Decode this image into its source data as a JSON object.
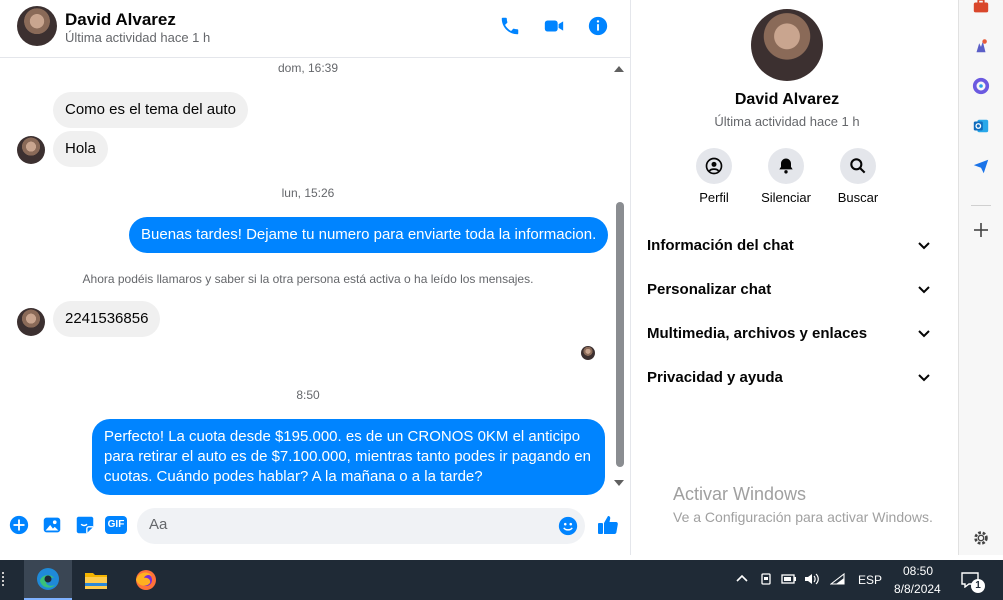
{
  "chat": {
    "name": "David Alvarez",
    "status": "Última actividad hace 1 h"
  },
  "messages": {
    "ts1": "dom, 16:39",
    "msg1": "Como es el tema del auto",
    "msg2": "Hola",
    "ts2": "lun, 15:26",
    "msg3": "Buenas tardes! Dejame tu numero para enviarte toda la informacion.",
    "notice": "Ahora podéis llamaros y saber si la otra persona está activa o ha leído los mensajes.",
    "msg4": "2241536856",
    "ts3": "8:50",
    "msg5_line1": "Perfecto! La cuota desde $195.000. es de un CRONOS 0KM el anticipo",
    "msg5_line2": "para retirar el auto es de $7.100.000, mientras tanto podes ir pagando en",
    "msg5_line3": "cuotas. Cuándo podes hablar? A la mañana o a la tarde?"
  },
  "composer": {
    "placeholder": "Aa",
    "gif_label": "GIF"
  },
  "info": {
    "name": "David Alvarez",
    "status": "Última actividad hace 1 h",
    "actions": [
      "Perfil",
      "Silenciar",
      "Buscar"
    ],
    "sections": [
      "Información del chat",
      "Personalizar chat",
      "Multimedia, archivos y enlaces",
      "Privacidad y ayuda"
    ]
  },
  "watermark": {
    "title": "Activar Windows",
    "subtitle": "Ve a Configuración para activar Windows."
  },
  "taskbar": {
    "lang": "ESP",
    "time": "08:50",
    "date": "8/8/2024",
    "notifications": "1"
  },
  "colors": {
    "accent": "#0084ff",
    "incoming_bubble": "#f0f0f0",
    "taskbar": "#1f2a36"
  }
}
